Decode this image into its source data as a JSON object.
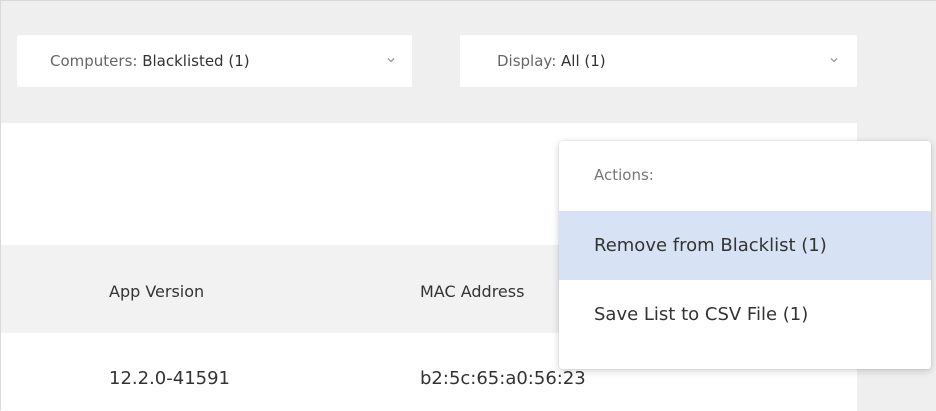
{
  "filters": {
    "computers": {
      "label": "Computers:",
      "value": "Blacklisted (1)"
    },
    "display": {
      "label": "Display:",
      "value": "All (1)"
    }
  },
  "table": {
    "columns": [
      "App Version",
      "MAC Address"
    ],
    "rows": [
      {
        "app_version": "12.2.0-41591",
        "mac_address": "b2:5c:65:a0:56:23"
      }
    ]
  },
  "actions_menu": {
    "header": "Actions:",
    "items": [
      {
        "label": "Remove from Blacklist (1)",
        "highlighted": true
      },
      {
        "label": "Save List to CSV File (1)",
        "highlighted": false
      }
    ]
  },
  "colors": {
    "highlight": "#d7e3f4",
    "page_background": "#efefef"
  },
  "icons": {
    "dropdown": "chevron-down-icon"
  }
}
